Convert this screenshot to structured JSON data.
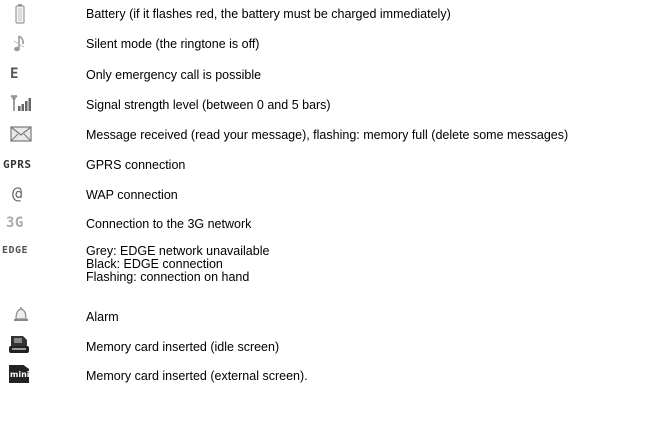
{
  "legend": [
    {
      "icon": "battery-icon",
      "lines": [
        "Battery (if it flashes red, the battery must be charged immediately)"
      ]
    },
    {
      "icon": "silent-mode-icon",
      "lines": [
        "Silent mode (the ringtone is off)"
      ]
    },
    {
      "icon": "emergency-e-icon",
      "icon_text": "E",
      "lines": [
        "Only emergency call is possible"
      ]
    },
    {
      "icon": "signal-strength-icon",
      "lines": [
        "Signal strength level (between 0 and 5 bars)"
      ]
    },
    {
      "icon": "envelope-icon",
      "lines": [
        "Message received (read your message), flashing: memory full (delete some messages)"
      ]
    },
    {
      "icon": "gprs-icon",
      "icon_text": "GPRS",
      "lines": [
        "GPRS connection"
      ]
    },
    {
      "icon": "wap-at-icon",
      "icon_text": "@",
      "lines": [
        "WAP connection"
      ]
    },
    {
      "icon": "3g-icon",
      "icon_text": "3G",
      "lines": [
        "Connection to the 3G network"
      ]
    },
    {
      "icon": "edge-icon",
      "icon_text": "EDGE",
      "lines": [
        "Grey: EDGE network unavailable",
        "Black: EDGE connection",
        "Flashing: connection on hand"
      ]
    },
    {
      "icon": "alarm-bell-icon",
      "lines": [
        "Alarm"
      ]
    },
    {
      "icon": "memory-card-idle-icon",
      "lines": [
        "Memory card inserted (idle screen)"
      ]
    },
    {
      "icon": "memory-card-external-icon",
      "icon_text": "mini",
      "lines": [
        "Memory card inserted (external screen)."
      ]
    }
  ]
}
